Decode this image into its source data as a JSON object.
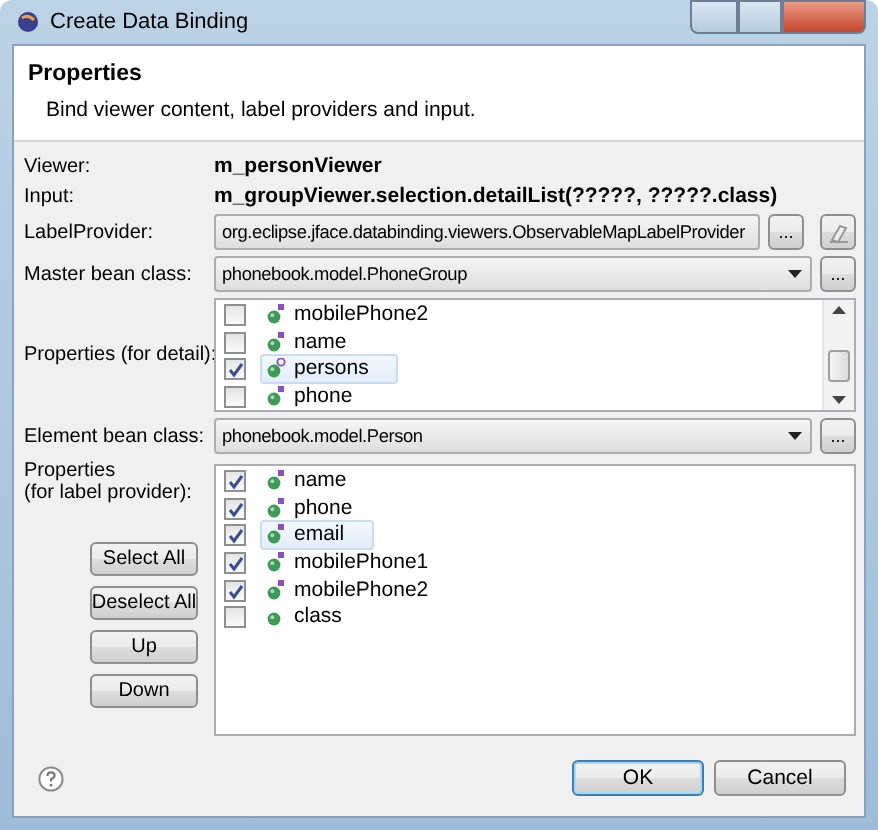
{
  "window": {
    "title": "Create Data Binding"
  },
  "header": {
    "title": "Properties",
    "description": "Bind viewer content, label providers and input."
  },
  "viewer": {
    "label": "Viewer:",
    "value": "m_personViewer"
  },
  "input": {
    "label": "Input:",
    "value": "m_groupViewer.selection.detailList(?????, ?????.class)"
  },
  "label_provider": {
    "label": "LabelProvider:",
    "value": "org.eclipse.jface.databinding.viewers.ObservableMapLabelProvider",
    "browse": "..."
  },
  "master_bean_class": {
    "label": "Master bean class:",
    "value": "phonebook.model.PhoneGroup",
    "browse": "..."
  },
  "properties_detail": {
    "label": "Properties (for detail):",
    "items": [
      {
        "label": "mobilePhone2",
        "checked": false,
        "selected": false,
        "kind": "static"
      },
      {
        "label": "name",
        "checked": false,
        "selected": false,
        "kind": "static"
      },
      {
        "label": "persons",
        "checked": true,
        "selected": true,
        "kind": "list"
      },
      {
        "label": "phone",
        "checked": false,
        "selected": false,
        "kind": "static"
      }
    ]
  },
  "element_bean_class": {
    "label": "Element bean class:",
    "value": "phonebook.model.Person",
    "browse": "..."
  },
  "properties_label": {
    "label": "Properties\n(for label provider):",
    "items": [
      {
        "label": "name",
        "checked": true,
        "selected": false,
        "kind": "static"
      },
      {
        "label": "phone",
        "checked": true,
        "selected": false,
        "kind": "static"
      },
      {
        "label": "email",
        "checked": true,
        "selected": true,
        "kind": "static"
      },
      {
        "label": "mobilePhone1",
        "checked": true,
        "selected": false,
        "kind": "static"
      },
      {
        "label": "mobilePhone2",
        "checked": true,
        "selected": false,
        "kind": "static"
      },
      {
        "label": "class",
        "checked": false,
        "selected": false,
        "kind": "plain"
      }
    ]
  },
  "side_buttons": [
    "Select All",
    "Deselect All",
    "Up",
    "Down"
  ],
  "buttons": [
    {
      "label": "OK",
      "default": true
    },
    {
      "label": "Cancel",
      "default": false
    }
  ]
}
